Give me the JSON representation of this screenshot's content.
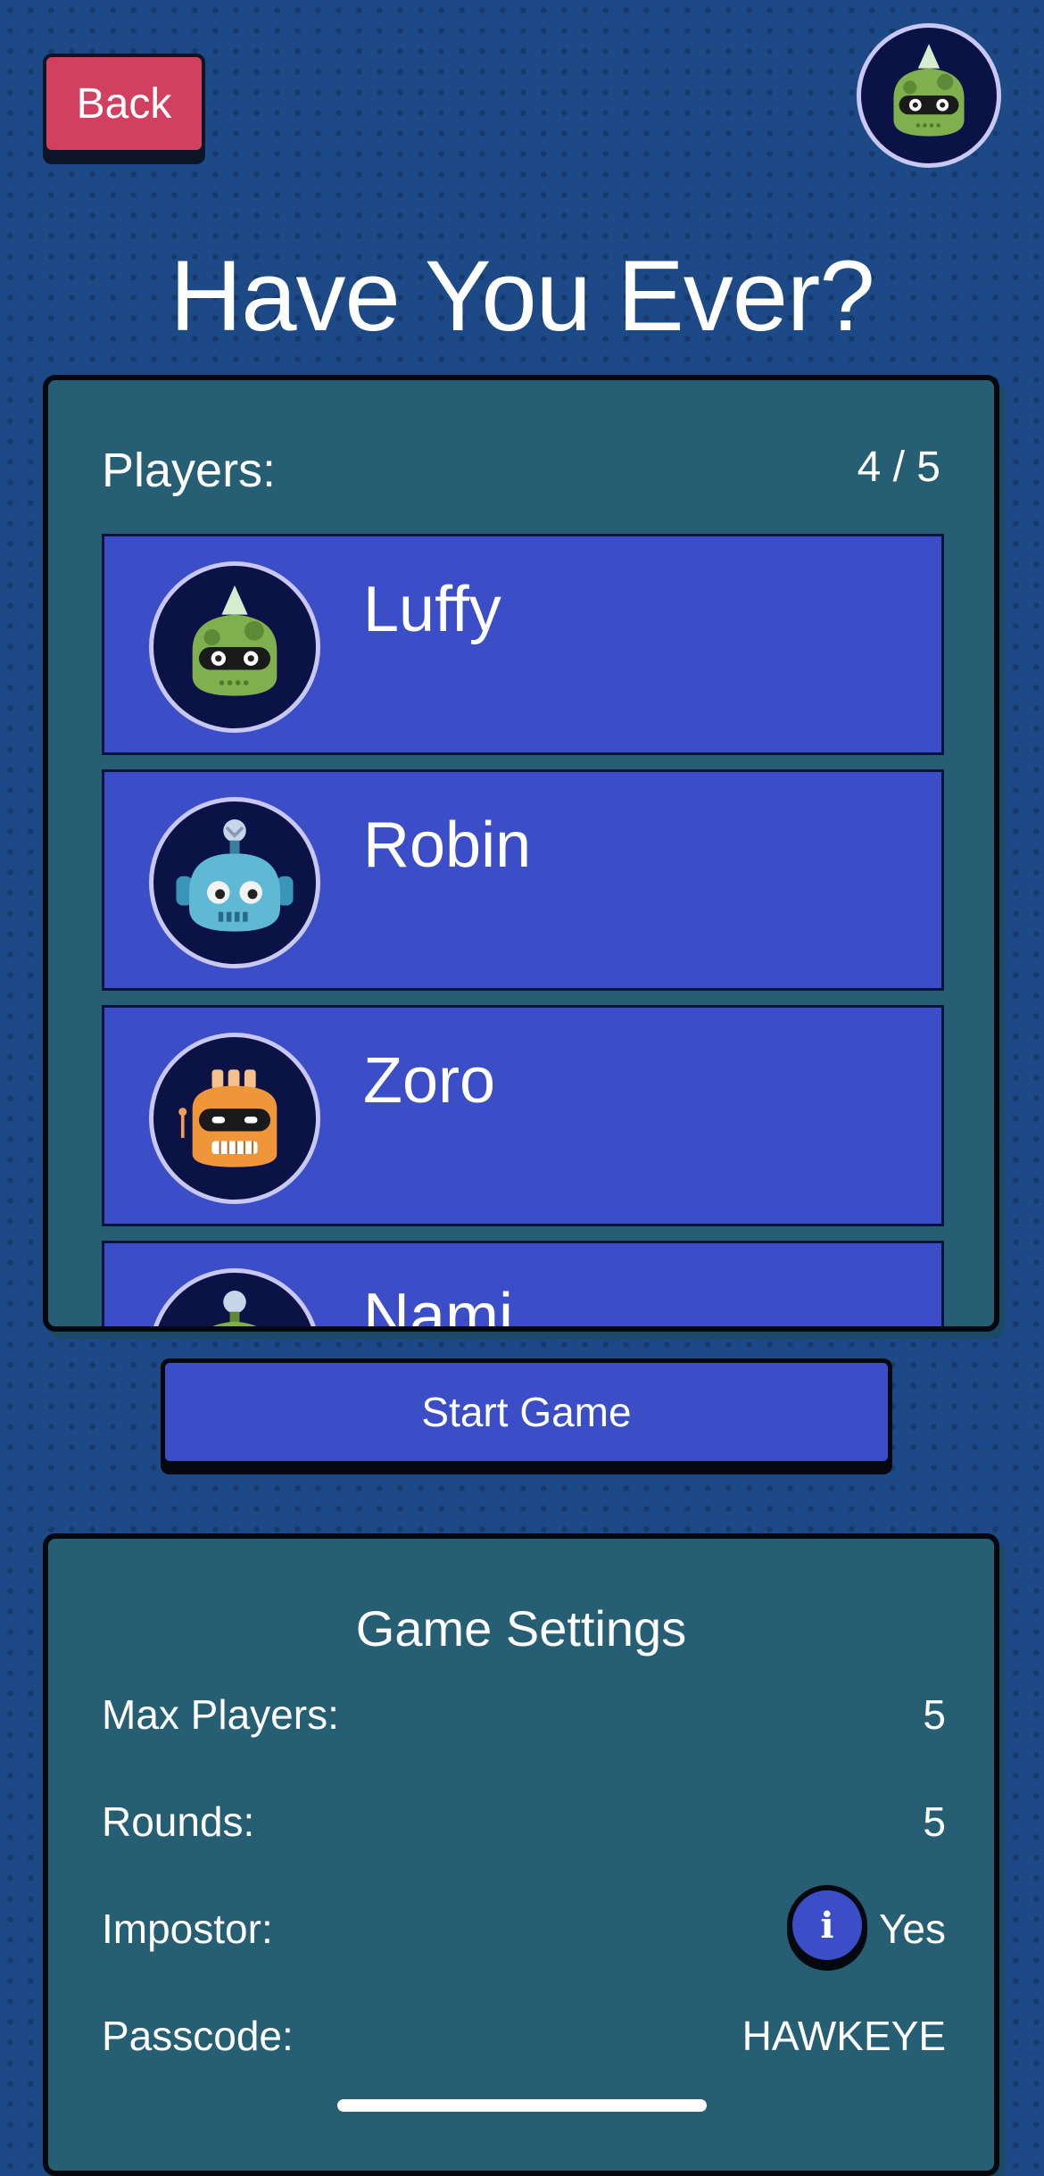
{
  "header": {
    "back_label": "Back",
    "title": "Have You Ever?",
    "profile_avatar": "green-robot-icon"
  },
  "players": {
    "label": "Players:",
    "count": "4 / 5",
    "list": [
      {
        "name": "Luffy",
        "avatar": "green-robot-icon"
      },
      {
        "name": "Robin",
        "avatar": "blue-robot-icon"
      },
      {
        "name": "Zoro",
        "avatar": "orange-robot-icon"
      },
      {
        "name": "Nami",
        "avatar": "green-robot-icon"
      }
    ]
  },
  "actions": {
    "start_label": "Start Game"
  },
  "settings": {
    "title": "Game Settings",
    "rows": [
      {
        "label": "Max Players:",
        "value": "5"
      },
      {
        "label": "Rounds:",
        "value": "5"
      },
      {
        "label": "Impostor:",
        "value": "Yes",
        "info_icon": "info-icon"
      },
      {
        "label": "Passcode:",
        "value": "HAWKEYE"
      }
    ]
  },
  "colors": {
    "background": "#1d4a86",
    "panel": "#265e74",
    "player_row": "#3b4ec7",
    "back_button": "#d2405f",
    "avatar_ring": "#c9c7f4"
  }
}
